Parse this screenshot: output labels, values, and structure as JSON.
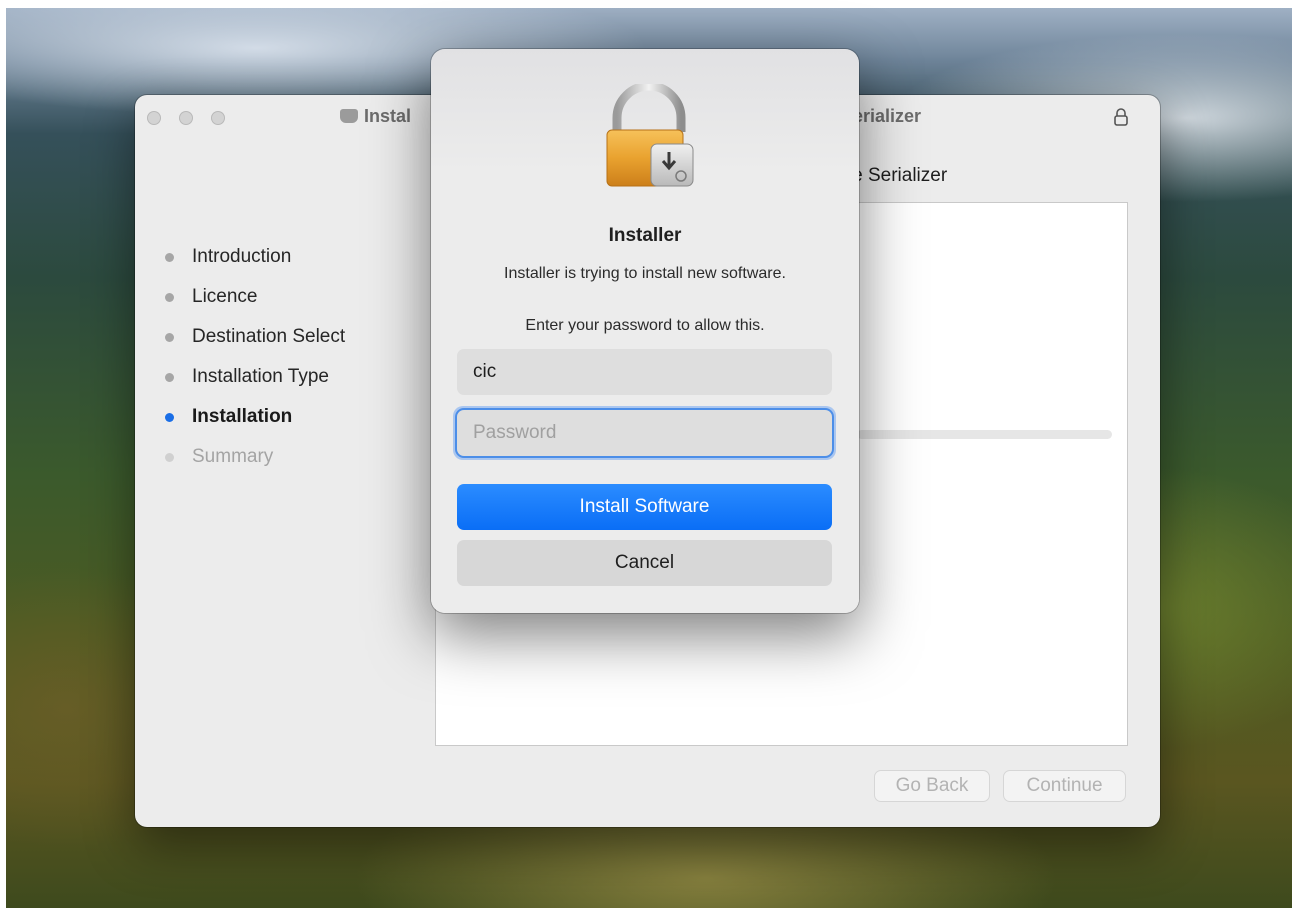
{
  "installer_window": {
    "title_left": "Instal",
    "title_right": "erializer",
    "content_title": "cense Serializer",
    "steps": [
      {
        "label": "Introduction",
        "state": "done"
      },
      {
        "label": "Licence",
        "state": "done"
      },
      {
        "label": "Destination Select",
        "state": "done"
      },
      {
        "label": "Installation Type",
        "state": "done"
      },
      {
        "label": "Installation",
        "state": "active"
      },
      {
        "label": "Summary",
        "state": "pending"
      }
    ],
    "go_back_label": "Go Back",
    "continue_label": "Continue"
  },
  "auth_dialog": {
    "title": "Installer",
    "message": "Installer is trying to install new software.",
    "prompt": "Enter your password to allow this.",
    "username_value": "cic",
    "password_placeholder": "Password",
    "install_label": "Install Software",
    "cancel_label": "Cancel"
  },
  "icons": {
    "window_lock": "lock-icon",
    "dialog_lock": "lock-disk-icon",
    "package": "package-icon"
  },
  "colors": {
    "accent": "#0a6ef6",
    "active_step_dot": "#1a6ee6"
  }
}
